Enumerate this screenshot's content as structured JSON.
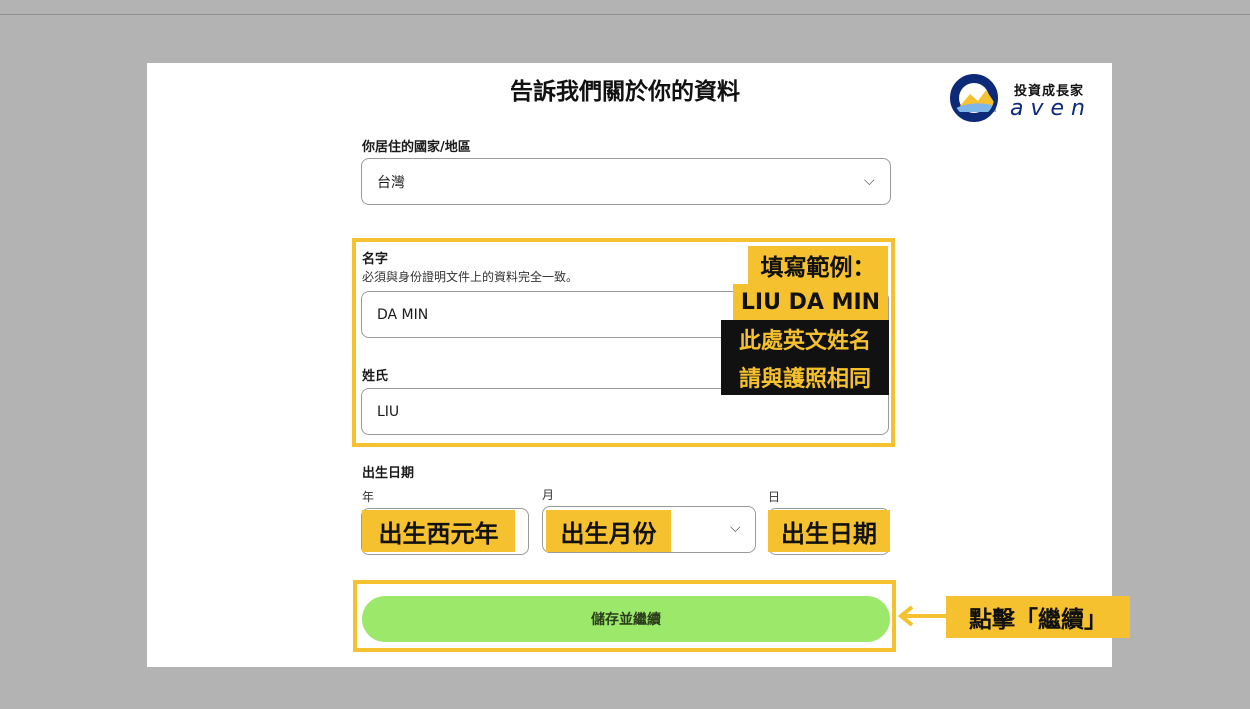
{
  "page": {
    "title": "告訴我們關於你的資料"
  },
  "logo": {
    "text_top": "投資成長家",
    "text_bottom": "aven"
  },
  "country": {
    "label": "你居住的國家/地區",
    "value": "台灣"
  },
  "first_name": {
    "label": "名字",
    "hint": "必須與身份證明文件上的資料完全一致。",
    "value": "DA MIN"
  },
  "last_name": {
    "label": "姓氏",
    "value": "LIU"
  },
  "dob": {
    "label": "出生日期",
    "year_label": "年",
    "month_label": "月",
    "day_label": "日",
    "year_tag": "出生西元年",
    "month_tag": "出生月份",
    "day_tag": "出生日期"
  },
  "annotations": {
    "example_title": "填寫範例：",
    "example_value": "LIU DA MIN",
    "note_line1": "此處英文姓名",
    "note_line2": "請與護照相同",
    "click_note": "點擊「繼續」"
  },
  "submit": {
    "label": "儲存並繼續"
  },
  "colors": {
    "highlight": "#f6c12e",
    "button": "#9be86b",
    "brand": "#0d2a78"
  }
}
